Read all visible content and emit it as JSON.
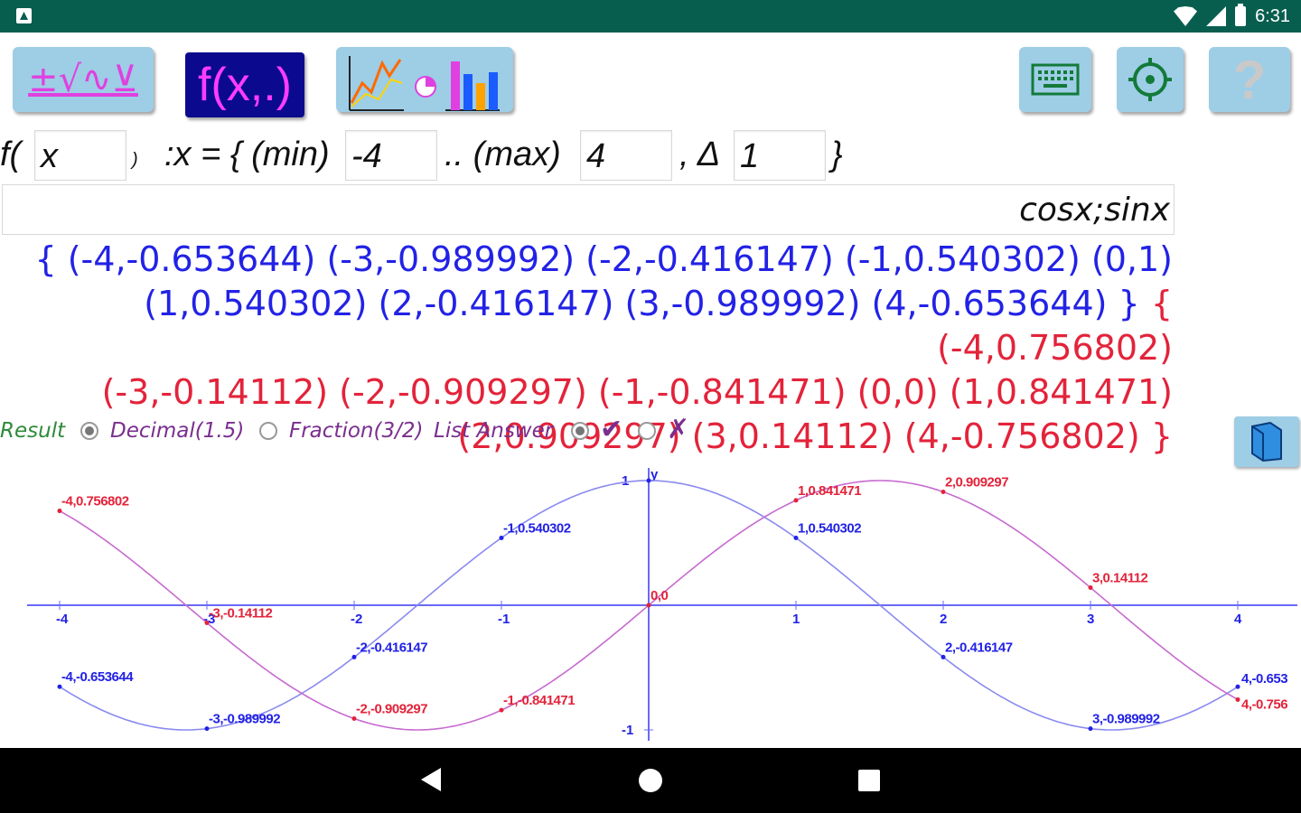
{
  "status": {
    "time": "6:31"
  },
  "toolbar": {
    "math_label": "±√∿⊻",
    "fx_label": "f(x,.)",
    "graph_icon": "line-pie-bar-chart-icon",
    "keyboard_icon": "keyboard-icon",
    "settings_icon": "settings-icon",
    "help_label": "?"
  },
  "range": {
    "f_prefix": "f(",
    "var_value": "x",
    "close_paren": ")",
    "assign_text": ":x = { (min)",
    "min_value": "-4",
    "dots_text": ".. (max)",
    "max_value": "4",
    "delta_text": ", Δ",
    "delta_value": "1",
    "close_brace": "}"
  },
  "expression": {
    "value": "cosx;sinx"
  },
  "results": {
    "line1_blue": "{ (-4,-0.653644) (-3,-0.989992) (-2,-0.416147) (-1,0.540302) (0,1)",
    "line2_blue": "(1,0.540302) (2,-0.416147) (3,-0.989992) (4,-0.653644) }",
    "line2_red": " { (-4,0.756802)",
    "line3_red": "(-3,-0.14112) (-2,-0.909297) (-1,-0.841471) (0,0) (1,0.841471)",
    "line4_red": "(2,0.909297) (3,0.14112) (4,-0.756802) }"
  },
  "options": {
    "result_label": "Result",
    "decimal_label": "Decimal(1.5)",
    "fraction_label": "Fraction(3/2)",
    "list_answer_label": "List Answer",
    "check_mark": "✔",
    "cross_mark": "✗",
    "decimal_selected": true,
    "list_yes_selected": true
  },
  "folder_icon": "folder-icon",
  "chart_data": {
    "type": "line",
    "xlim": [
      -4,
      4
    ],
    "ylim": [
      -1,
      1
    ],
    "x_ticks": [
      "-4",
      "-3",
      "-2",
      "-1",
      "1",
      "2",
      "3",
      "4"
    ],
    "y_ticks": [
      "1",
      "-1"
    ],
    "y_axis_label": "y",
    "series": [
      {
        "color": "#2222e6",
        "curve_color": "#8a8af0",
        "x": [
          -4,
          -3,
          -2,
          -1,
          0,
          1,
          2,
          3,
          4
        ],
        "y": [
          -0.653644,
          -0.989992,
          -0.416147,
          0.540302,
          1,
          0.540302,
          -0.416147,
          -0.989992,
          -0.653644
        ],
        "labels": [
          "-4,-0.653644",
          "-3,-0.989992",
          "-2,-0.416147",
          "-1,0.540302",
          "",
          "1,0.540302",
          "2,-0.416147",
          "3,-0.989992",
          "4,-0.653"
        ]
      },
      {
        "color": "#e3233a",
        "curve_color": "#c76ad0",
        "x": [
          -4,
          -3,
          -2,
          -1,
          0,
          1,
          2,
          3,
          4
        ],
        "y": [
          0.756802,
          -0.14112,
          -0.909297,
          -0.841471,
          0,
          0.841471,
          0.909297,
          0.14112,
          -0.756802
        ],
        "labels": [
          "-4,0.756802",
          "-3,-0.14112",
          "-2,-0.909297",
          "-1,-0.841471",
          "0,0",
          "1,0.841471",
          "2,0.909297",
          "3,0.14112",
          "4,-0.756"
        ]
      }
    ]
  }
}
